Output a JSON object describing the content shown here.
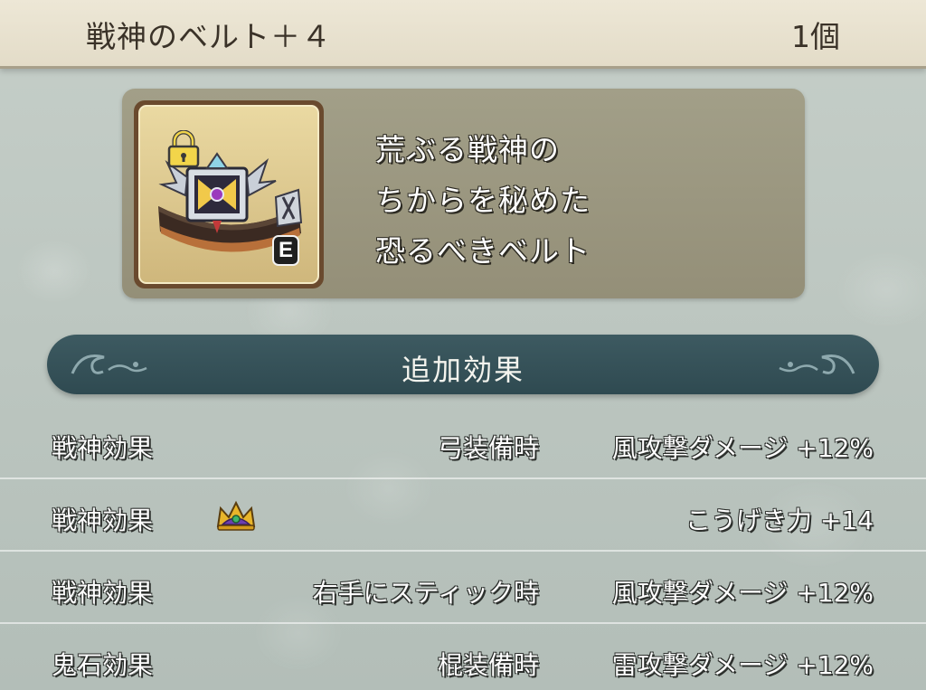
{
  "header": {
    "item_name": "戦神のベルト＋４",
    "count": "1個"
  },
  "item": {
    "icon": "belt-icon",
    "locked": true,
    "equipped_badge": "E",
    "description": [
      "荒ぶる戦神の",
      "ちからを秘めた",
      "恐るべきベルト"
    ]
  },
  "section": {
    "title": "追加効果"
  },
  "effects": [
    {
      "label": "戦神効果",
      "condition": "弓装備時",
      "effect": "風攻撃ダメージ +12%",
      "icon": null
    },
    {
      "label": "戦神効果",
      "condition": "",
      "effect": "こうげき力 +14",
      "icon": "crown-icon"
    },
    {
      "label": "戦神効果",
      "condition": "右手にスティック時",
      "effect": "風攻撃ダメージ +12%",
      "icon": null
    },
    {
      "label": "鬼石効果",
      "condition": "棍装備時",
      "effect": "雷攻撃ダメージ +12%",
      "icon": null
    }
  ],
  "colors": {
    "header_bg": "#e3dcc8",
    "banner_bg": "#2f4a51",
    "panel_bg": "#948f78",
    "background": "#b9c3bd"
  }
}
